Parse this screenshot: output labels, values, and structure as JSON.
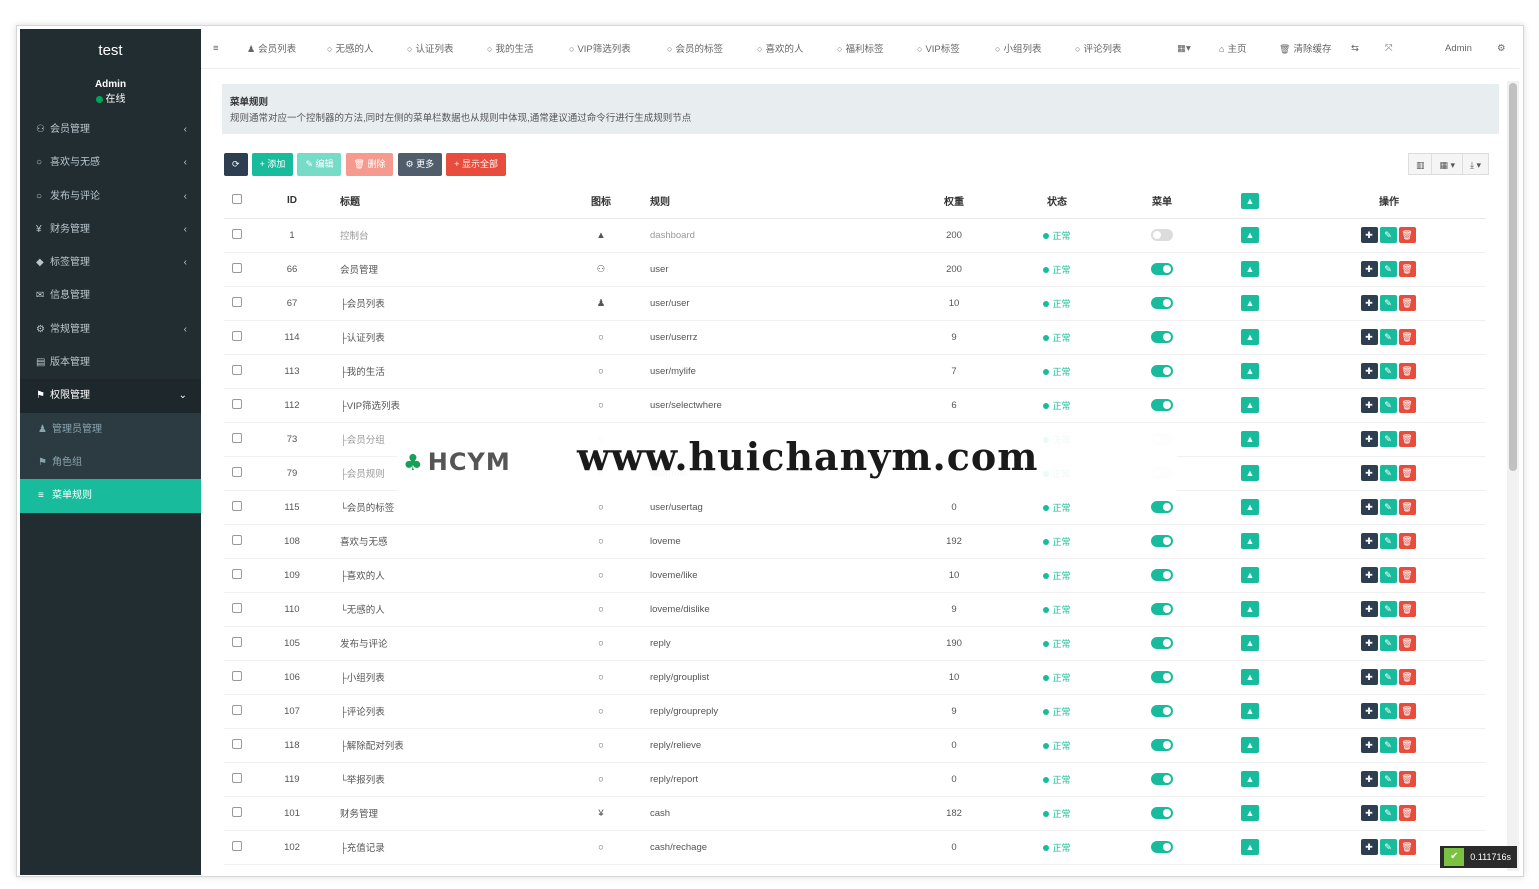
{
  "sidebar": {
    "logo": "test",
    "user": {
      "name": "Admin",
      "status": "在线"
    },
    "menu": [
      {
        "icon": "⚇",
        "label": "会员管理",
        "arrow": "‹"
      },
      {
        "icon": "○",
        "label": "喜欢与无感",
        "arrow": "‹"
      },
      {
        "icon": "○",
        "label": "发布与评论",
        "arrow": "‹"
      },
      {
        "icon": "¥",
        "label": "财务管理",
        "arrow": "‹"
      },
      {
        "icon": "◆",
        "label": "标签管理",
        "arrow": "‹"
      },
      {
        "icon": "✉",
        "label": "信息管理",
        "arrow": ""
      },
      {
        "icon": "⚙",
        "label": "常规管理",
        "arrow": "‹"
      },
      {
        "icon": "▤",
        "label": "版本管理",
        "arrow": ""
      },
      {
        "icon": "⚑",
        "label": "权限管理",
        "arrow": "⌄"
      }
    ],
    "submenu": [
      {
        "icon": "♟",
        "label": "管理员管理"
      },
      {
        "icon": "⚑",
        "label": "角色组"
      },
      {
        "icon": "≡",
        "label": "菜单规则"
      }
    ]
  },
  "topbar": {
    "hamburger": "≡",
    "tabs": [
      {
        "icon": "♟",
        "label": "会员列表"
      },
      {
        "icon": "○",
        "label": "无感的人"
      },
      {
        "icon": "○",
        "label": "认证列表"
      },
      {
        "icon": "○",
        "label": "我的生活"
      },
      {
        "icon": "○",
        "label": "VIP筛选列表"
      },
      {
        "icon": "○",
        "label": "会员的标签"
      },
      {
        "icon": "○",
        "label": "喜欢的人"
      },
      {
        "icon": "○",
        "label": "福利标签"
      },
      {
        "icon": "○",
        "label": "VIP标签"
      },
      {
        "icon": "○",
        "label": "小组列表"
      },
      {
        "icon": "○",
        "label": "评论列表"
      }
    ],
    "more": "▦▾",
    "home": "主页",
    "clear_cache": "清除缓存",
    "admin": "Admin"
  },
  "panel": {
    "title": "菜单规则",
    "description": "规则通常对应一个控制器的方法,同时左侧的菜单栏数据也从规则中体现,通常建议通过命令行进行生成规则节点"
  },
  "toolbar": {
    "refresh": "⟳",
    "add": "+ 添加",
    "edit": "✎ 编辑",
    "delete": "🗑 删除",
    "more": "⚙ 更多",
    "toggle_all": "+ 显示全部"
  },
  "table": {
    "headers": {
      "id": "ID",
      "title": "标题",
      "icon": "图标",
      "rule": "规则",
      "weigh": "权重",
      "status": "状态",
      "menu": "菜单"
    },
    "status_label": "正常",
    "rows": [
      {
        "id": "1",
        "title": "控制台",
        "icon": "▲",
        "rule": "dashboard",
        "weigh": "200",
        "menu": false,
        "muted": true
      },
      {
        "id": "66",
        "title": "会员管理",
        "icon": "⚇",
        "rule": "user",
        "weigh": "200",
        "menu": true
      },
      {
        "id": "67",
        "title": "├会员列表",
        "icon": "♟",
        "rule": "user/user",
        "weigh": "10",
        "menu": true
      },
      {
        "id": "114",
        "title": "├认证列表",
        "icon": "○",
        "rule": "user/userrz",
        "weigh": "9",
        "menu": true
      },
      {
        "id": "113",
        "title": "├我的生活",
        "icon": "○",
        "rule": "user/mylife",
        "weigh": "7",
        "menu": true
      },
      {
        "id": "112",
        "title": "├VIP筛选列表",
        "icon": "○",
        "rule": "user/selectwhere",
        "weigh": "6",
        "menu": true
      },
      {
        "id": "73",
        "title": "├会员分组",
        "icon": "○",
        "rule": "",
        "weigh": "",
        "menu": false,
        "muted": true
      },
      {
        "id": "79",
        "title": "├会员规则",
        "icon": "○",
        "rule": "user/rule",
        "weigh": "",
        "menu": false,
        "muted": true
      },
      {
        "id": "115",
        "title": "└会员的标签",
        "icon": "○",
        "rule": "user/usertag",
        "weigh": "0",
        "menu": true
      },
      {
        "id": "108",
        "title": "喜欢与无感",
        "icon": "○",
        "rule": "loveme",
        "weigh": "192",
        "menu": true
      },
      {
        "id": "109",
        "title": "├喜欢的人",
        "icon": "○",
        "rule": "loveme/like",
        "weigh": "10",
        "menu": true
      },
      {
        "id": "110",
        "title": "└无感的人",
        "icon": "○",
        "rule": "loveme/dislike",
        "weigh": "9",
        "menu": true
      },
      {
        "id": "105",
        "title": "发布与评论",
        "icon": "○",
        "rule": "reply",
        "weigh": "190",
        "menu": true
      },
      {
        "id": "106",
        "title": "├小组列表",
        "icon": "○",
        "rule": "reply/grouplist",
        "weigh": "10",
        "menu": true
      },
      {
        "id": "107",
        "title": "├评论列表",
        "icon": "○",
        "rule": "reply/groupreply",
        "weigh": "9",
        "menu": true
      },
      {
        "id": "118",
        "title": "├解除配对列表",
        "icon": "○",
        "rule": "reply/relieve",
        "weigh": "0",
        "menu": true
      },
      {
        "id": "119",
        "title": "└举报列表",
        "icon": "○",
        "rule": "reply/report",
        "weigh": "0",
        "menu": true
      },
      {
        "id": "101",
        "title": "财务管理",
        "icon": "¥",
        "rule": "cash",
        "weigh": "182",
        "menu": true
      },
      {
        "id": "102",
        "title": "├充值记录",
        "icon": "○",
        "rule": "cash/rechage",
        "weigh": "0",
        "menu": true
      }
    ]
  },
  "watermark": {
    "logo": "HCYM",
    "url": "www.huichanym.com"
  },
  "timer": "0.111716s",
  "colors": {
    "sidebar": "#222d32",
    "accent": "#18bc9c",
    "danger": "#e74c3c",
    "dark": "#2c3e50"
  }
}
